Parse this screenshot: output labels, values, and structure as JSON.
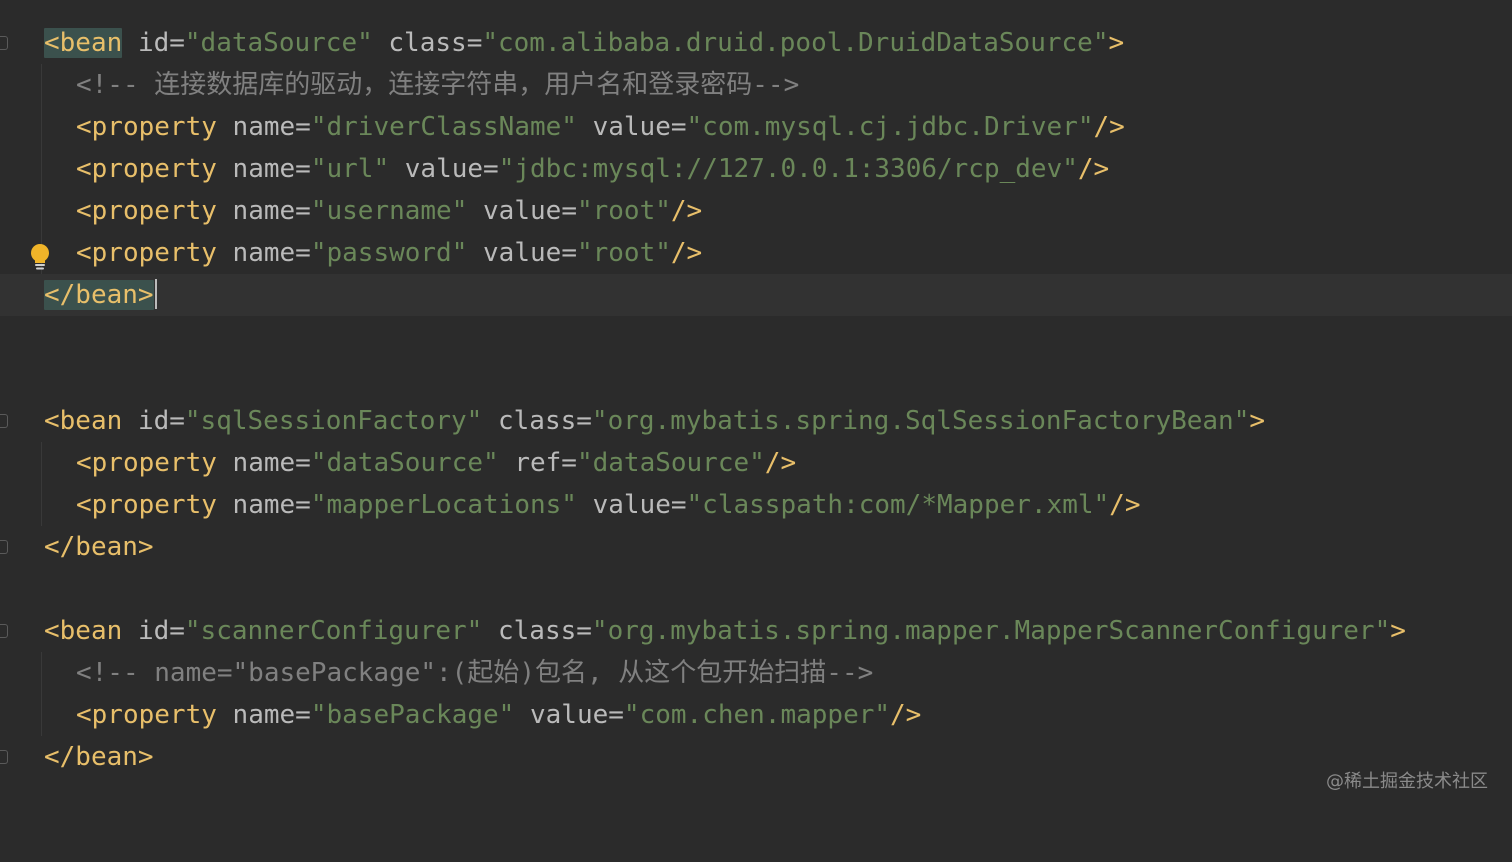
{
  "editor": {
    "lines": [
      {
        "tag_open": "<bean",
        "a1": "id",
        "v1": "\"dataSource\"",
        "a2": "class",
        "v2": "\"com.alibaba.druid.pool.DruidDataSource\"",
        "close": ">"
      },
      {
        "comment": "<!-- 连接数据库的驱动，连接字符串，用户名和登录密码-->"
      },
      {
        "tag_open": "<property",
        "a1": "name",
        "v1": "\"driverClassName\"",
        "a2": "value",
        "v2": "\"com.mysql.cj.jdbc.Driver\"",
        "close": "/>"
      },
      {
        "tag_open": "<property",
        "a1": "name",
        "v1": "\"url\"",
        "a2": "value",
        "v2": "\"jdbc:mysql://127.0.0.1:3306/rcp_dev\"",
        "close": "/>"
      },
      {
        "tag_open": "<property",
        "a1": "name",
        "v1": "\"username\"",
        "a2": "value",
        "v2": "\"root\"",
        "close": "/>"
      },
      {
        "tag_open": "<property",
        "a1": "name",
        "v1": "\"password\"",
        "a2": "value",
        "v2": "\"root\"",
        "close": "/>"
      },
      {
        "tag_close": "</bean>"
      },
      {
        "tag_open": "<bean",
        "a1": "id",
        "v1": "\"sqlSessionFactory\"",
        "a2": "class",
        "v2": "\"org.mybatis.spring.SqlSessionFactoryBean\"",
        "close": ">"
      },
      {
        "tag_open": "<property",
        "a1": "name",
        "v1": "\"dataSource\"",
        "a2": "ref",
        "v2": "\"dataSource\"",
        "close": "/>"
      },
      {
        "tag_open": "<property",
        "a1": "name",
        "v1": "\"mapperLocations\"",
        "a2": "value",
        "v2": "\"classpath:com/*Mapper.xml\"",
        "close": "/>"
      },
      {
        "tag_close": "</bean>"
      },
      {
        "tag_open": "<bean",
        "a1": "id",
        "v1": "\"scannerConfigurer\"",
        "a2": "class",
        "v2": "\"org.mybatis.spring.mapper.MapperScannerConfigurer\"",
        "close": ">"
      },
      {
        "comment": "<!-- name=\"basePackage\":(起始)包名, 从这个包开始扫描-->"
      },
      {
        "tag_open": "<property",
        "a1": "name",
        "v1": "\"basePackage\"",
        "a2": "value",
        "v2": "\"com.chen.mapper\"",
        "close": "/>"
      },
      {
        "tag_close": "</bean>"
      }
    ],
    "eq": "=",
    "bean_open": "<bean",
    "bean_close": "</bean>"
  },
  "gutter": {
    "intention_icon": "lightbulb-icon",
    "fold_icon": "fold-marker-icon"
  },
  "watermark": "@稀土掘金技术社区",
  "colors": {
    "background": "#2b2b2b",
    "current_line": "#323232",
    "tag": "#e8bf6a",
    "attribute": "#bababa",
    "string": "#6a8759",
    "comment": "#808080",
    "bracket_match": "#3b514d",
    "bulb": "#f0b429"
  }
}
